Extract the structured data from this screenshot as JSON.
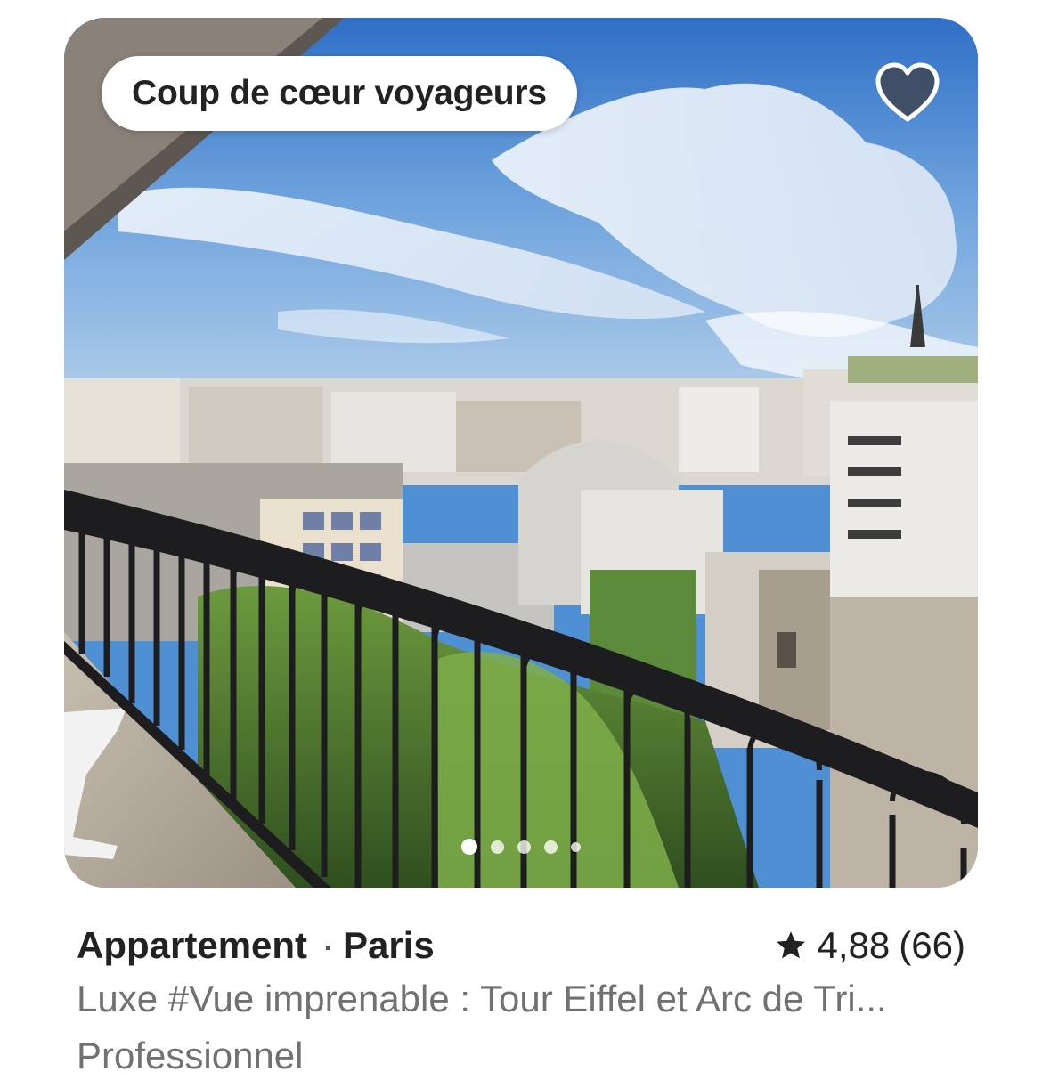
{
  "listing": {
    "badge": "Coup de cœur voyageurs",
    "favorite_icon": "heart-icon",
    "photo": {
      "subject": "balcony-view-paris-rooftops",
      "total_images": 5,
      "current_index": 1
    },
    "property_type": "Appartement",
    "separator": "·",
    "city": "Paris",
    "rating": {
      "icon": "star-icon",
      "score": "4,88",
      "count": "(66)"
    },
    "title": "Luxe #Vue imprenable : Tour Eiffel et Arc de Tri...",
    "host_type": "Professionnel"
  },
  "colors": {
    "text_primary": "#222222",
    "text_secondary": "#717171",
    "badge_bg": "#ffffff",
    "heart_fill": "#3f4555"
  }
}
